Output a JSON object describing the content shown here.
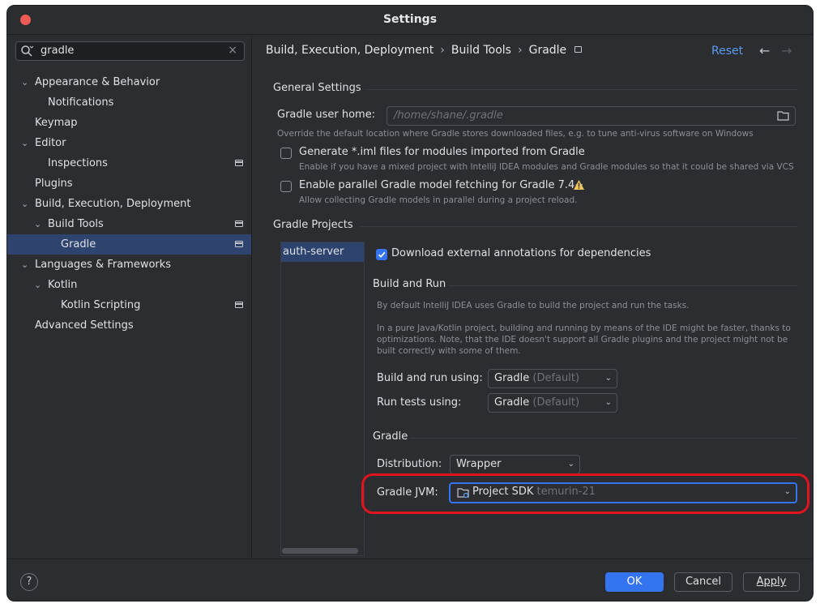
{
  "window": {
    "title": "Settings"
  },
  "search": {
    "value": "gradle"
  },
  "sidebar": {
    "items": [
      {
        "label": "Appearance & Behavior"
      },
      {
        "label": "Notifications"
      },
      {
        "label": "Keymap"
      },
      {
        "label": "Editor"
      },
      {
        "label": "Inspections"
      },
      {
        "label": "Plugins"
      },
      {
        "label": "Build, Execution, Deployment"
      },
      {
        "label": "Build Tools"
      },
      {
        "label": "Gradle"
      },
      {
        "label": "Languages & Frameworks"
      },
      {
        "label": "Kotlin"
      },
      {
        "label": "Kotlin Scripting"
      },
      {
        "label": "Advanced Settings"
      }
    ]
  },
  "breadcrumb": {
    "part1": "Build, Execution, Deployment",
    "part2": "Build Tools",
    "part3": "Gradle",
    "sep": "›"
  },
  "header": {
    "reset": "Reset",
    "back": "←",
    "forward": "→"
  },
  "general": {
    "title": "General Settings",
    "user_home_label": "Gradle user home:",
    "user_home_placeholder": "/home/shane/.gradle",
    "user_home_hint": "Override the default location where Gradle stores downloaded files, e.g. to tune anti-virus software on Windows",
    "iml_label": "Generate *.iml files for modules imported from Gradle",
    "iml_hint": "Enable if you have a mixed project with IntelliJ IDEA modules and Gradle modules so that it could be shared via VCS",
    "parallel_label": "Enable parallel Gradle model fetching for Gradle 7.4+",
    "parallel_hint": "Allow collecting Gradle models in parallel during a project reload."
  },
  "projects": {
    "title": "Gradle Projects",
    "items": [
      "auth-server"
    ],
    "download_annotations_label": "Download external annotations for dependencies"
  },
  "build_run": {
    "title": "Build and Run",
    "hint1": "By default IntelliJ IDEA uses Gradle to build the project and run the tasks.",
    "hint2_line1": "In a pure Java/Kotlin project, building and running by means of the IDE might be faster, thanks to",
    "hint2_line2": "optimizations. Note, that the IDE doesn't support all Gradle plugins and the project might not be",
    "hint2_line3": "built correctly with some of them.",
    "build_run_using_label": "Build and run using:",
    "build_run_using_value": "Gradle",
    "build_run_using_suffix": "(Default)",
    "run_tests_label": "Run tests using:",
    "run_tests_value": "Gradle",
    "run_tests_suffix": "(Default)"
  },
  "gradle": {
    "title": "Gradle",
    "distribution_label": "Distribution:",
    "distribution_value": "Wrapper",
    "jvm_label": "Gradle JVM:",
    "jvm_value": "Project SDK",
    "jvm_detail": "temurin-21"
  },
  "footer": {
    "help": "?",
    "ok": "OK",
    "cancel": "Cancel",
    "apply": "Apply"
  },
  "colors": {
    "accent": "#3574f0",
    "highlight": "#e0141e",
    "selection": "#2e436e",
    "link": "#5b9cf5"
  }
}
